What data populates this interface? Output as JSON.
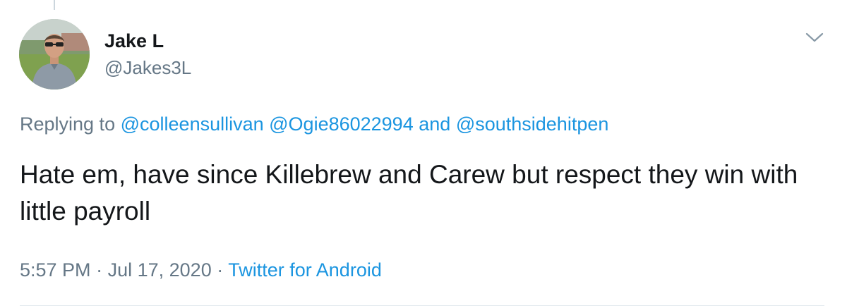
{
  "user": {
    "display_name": "Jake L",
    "handle": "@Jakes3L",
    "avatar_icon": "profile-photo"
  },
  "reply": {
    "prefix": "Replying to",
    "mentions": [
      "@colleensullivan",
      "@Ogie86022994",
      "@southsidehitpen"
    ],
    "conjunction": "and"
  },
  "tweet": {
    "text": "Hate em, have since Killebrew and Carew but respect they win with little payroll"
  },
  "meta": {
    "time": "5:57 PM",
    "separator": "·",
    "date": "Jul 17, 2020",
    "source": "Twitter for Android"
  },
  "menu": {
    "icon": "chevron-down-icon"
  },
  "colors": {
    "link": "#1b95e0",
    "secondary_text": "#657786",
    "primary_text": "#14171a",
    "divider": "#e6ecf0"
  }
}
